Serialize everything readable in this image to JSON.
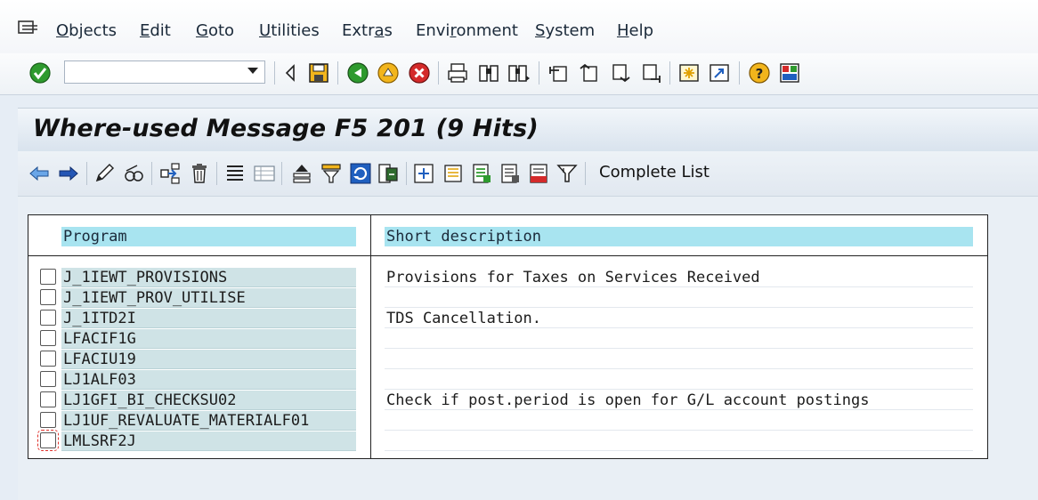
{
  "menu": {
    "items": [
      {
        "id": "objects",
        "pre": "",
        "ul": "O",
        "post": "bjects"
      },
      {
        "id": "edit",
        "pre": "",
        "ul": "E",
        "post": "dit"
      },
      {
        "id": "goto",
        "pre": "",
        "ul": "G",
        "post": "oto"
      },
      {
        "id": "utilities",
        "pre": "",
        "ul": "U",
        "post": "tilities"
      },
      {
        "id": "extras",
        "pre": "Extr",
        "ul": "a",
        "post": "s"
      },
      {
        "id": "environment",
        "pre": "Envi",
        "ul": "r",
        "post": "onment"
      },
      {
        "id": "system",
        "pre": "",
        "ul": "S",
        "post": "ystem"
      },
      {
        "id": "help",
        "pre": "",
        "ul": "H",
        "post": "elp"
      }
    ]
  },
  "command_field": {
    "value": "",
    "placeholder": ""
  },
  "title": "Where-used Message F5 201 (9 Hits)",
  "app_toolbar": {
    "complete_list": "Complete List"
  },
  "table": {
    "headers": {
      "program": "Program",
      "description": "Short description"
    },
    "rows": [
      {
        "program": "J_1IEWT_PROVISIONS",
        "description": "Provisions for Taxes on Services Received"
      },
      {
        "program": "J_1IEWT_PROV_UTILISE",
        "description": ""
      },
      {
        "program": "J_1ITD2I",
        "description": "TDS Cancellation."
      },
      {
        "program": "LFACIF1G",
        "description": ""
      },
      {
        "program": "LFACIU19",
        "description": ""
      },
      {
        "program": "LJ1ALF03",
        "description": ""
      },
      {
        "program": "LJ1GFI_BI_CHECKSU02",
        "description": "Check if post.period is open for G/L account postings"
      },
      {
        "program": "LJ1UF_REVALUATE_MATERIALF01",
        "description": ""
      },
      {
        "program": "LMLSRF2J",
        "description": ""
      }
    ]
  },
  "colors": {
    "header_fill": "#a8e4f0",
    "program_fill": "#cfe3e6",
    "accent_green": "#2e9a2e",
    "accent_red": "#d42a2a",
    "accent_yellow": "#f2b51c"
  }
}
